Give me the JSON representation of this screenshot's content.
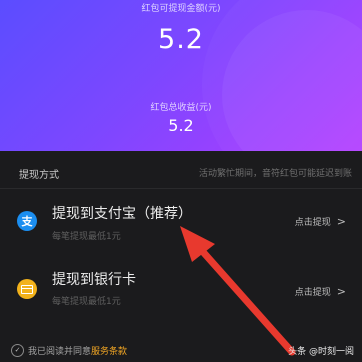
{
  "hero": {
    "amount_label": "红包可提现金额(元)",
    "amount_value": "5.2",
    "total_label": "红包总收益(元)",
    "total_value": "5.2"
  },
  "methods": {
    "title": "提现方式",
    "note": "活动繁忙期间，音符红包可能延迟到账",
    "items": [
      {
        "title": "提现到支付宝（推荐）",
        "sub": "每笔提现最低1元",
        "action": "点击提现",
        "icon": "alipay-icon"
      },
      {
        "title": "提现到银行卡",
        "sub": "每笔提现最低1元",
        "action": "点击提现",
        "icon": "bank-card-icon"
      }
    ]
  },
  "footer": {
    "agree_prefix": "我已阅读并同意",
    "agree_link": "服务条款",
    "watermark": "头条 @时刻一阅"
  },
  "colors": {
    "accent_link": "#f0a524",
    "alipay_blue": "#1b8ef0",
    "bank_yellow": "#f2b21b",
    "arrow_red": "#e8392e"
  }
}
